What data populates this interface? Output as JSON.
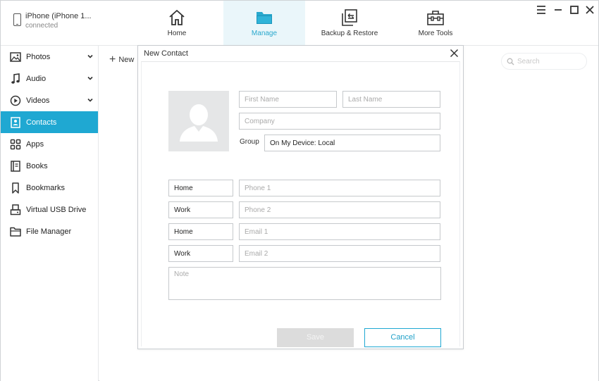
{
  "device": {
    "name": "iPhone (iPhone 1...",
    "status": "connected"
  },
  "nav_tabs": [
    {
      "label": "Home",
      "icon": "home-icon"
    },
    {
      "label": "Manage",
      "icon": "folder-icon",
      "active": true
    },
    {
      "label": "Backup & Restore",
      "icon": "backup-restore-icon"
    },
    {
      "label": "More Tools",
      "icon": "toolbox-icon"
    }
  ],
  "sidebar": {
    "items": [
      {
        "label": "Photos",
        "icon": "photo-icon",
        "expandable": true
      },
      {
        "label": "Audio",
        "icon": "music-note-icon",
        "expandable": true
      },
      {
        "label": "Videos",
        "icon": "play-circle-icon",
        "expandable": true
      },
      {
        "label": "Contacts",
        "icon": "contact-card-icon",
        "active": true
      },
      {
        "label": "Apps",
        "icon": "apps-grid-icon"
      },
      {
        "label": "Books",
        "icon": "book-icon"
      },
      {
        "label": "Bookmarks",
        "icon": "bookmark-icon"
      },
      {
        "label": "Virtual USB Drive",
        "icon": "usb-drive-icon"
      },
      {
        "label": "File Manager",
        "icon": "folder-outline-icon"
      }
    ]
  },
  "toolbar": {
    "new_label": "New"
  },
  "search": {
    "placeholder": "Search"
  },
  "dialog": {
    "title": "New Contact",
    "first_name_placeholder": "First Name",
    "last_name_placeholder": "Last Name",
    "company_placeholder": "Company",
    "group_label": "Group",
    "group_value": "On My Device: Local",
    "rows": [
      {
        "type": "Home",
        "placeholder": "Phone 1"
      },
      {
        "type": "Work",
        "placeholder": "Phone 2"
      },
      {
        "type": "Home",
        "placeholder": "Email 1"
      },
      {
        "type": "Work",
        "placeholder": "Email 2"
      }
    ],
    "note_placeholder": "Note",
    "save_label": "Save",
    "cancel_label": "Cancel"
  },
  "colors": {
    "accent": "#1fa8d2",
    "active_tab_bg": "#eaf6fa"
  }
}
